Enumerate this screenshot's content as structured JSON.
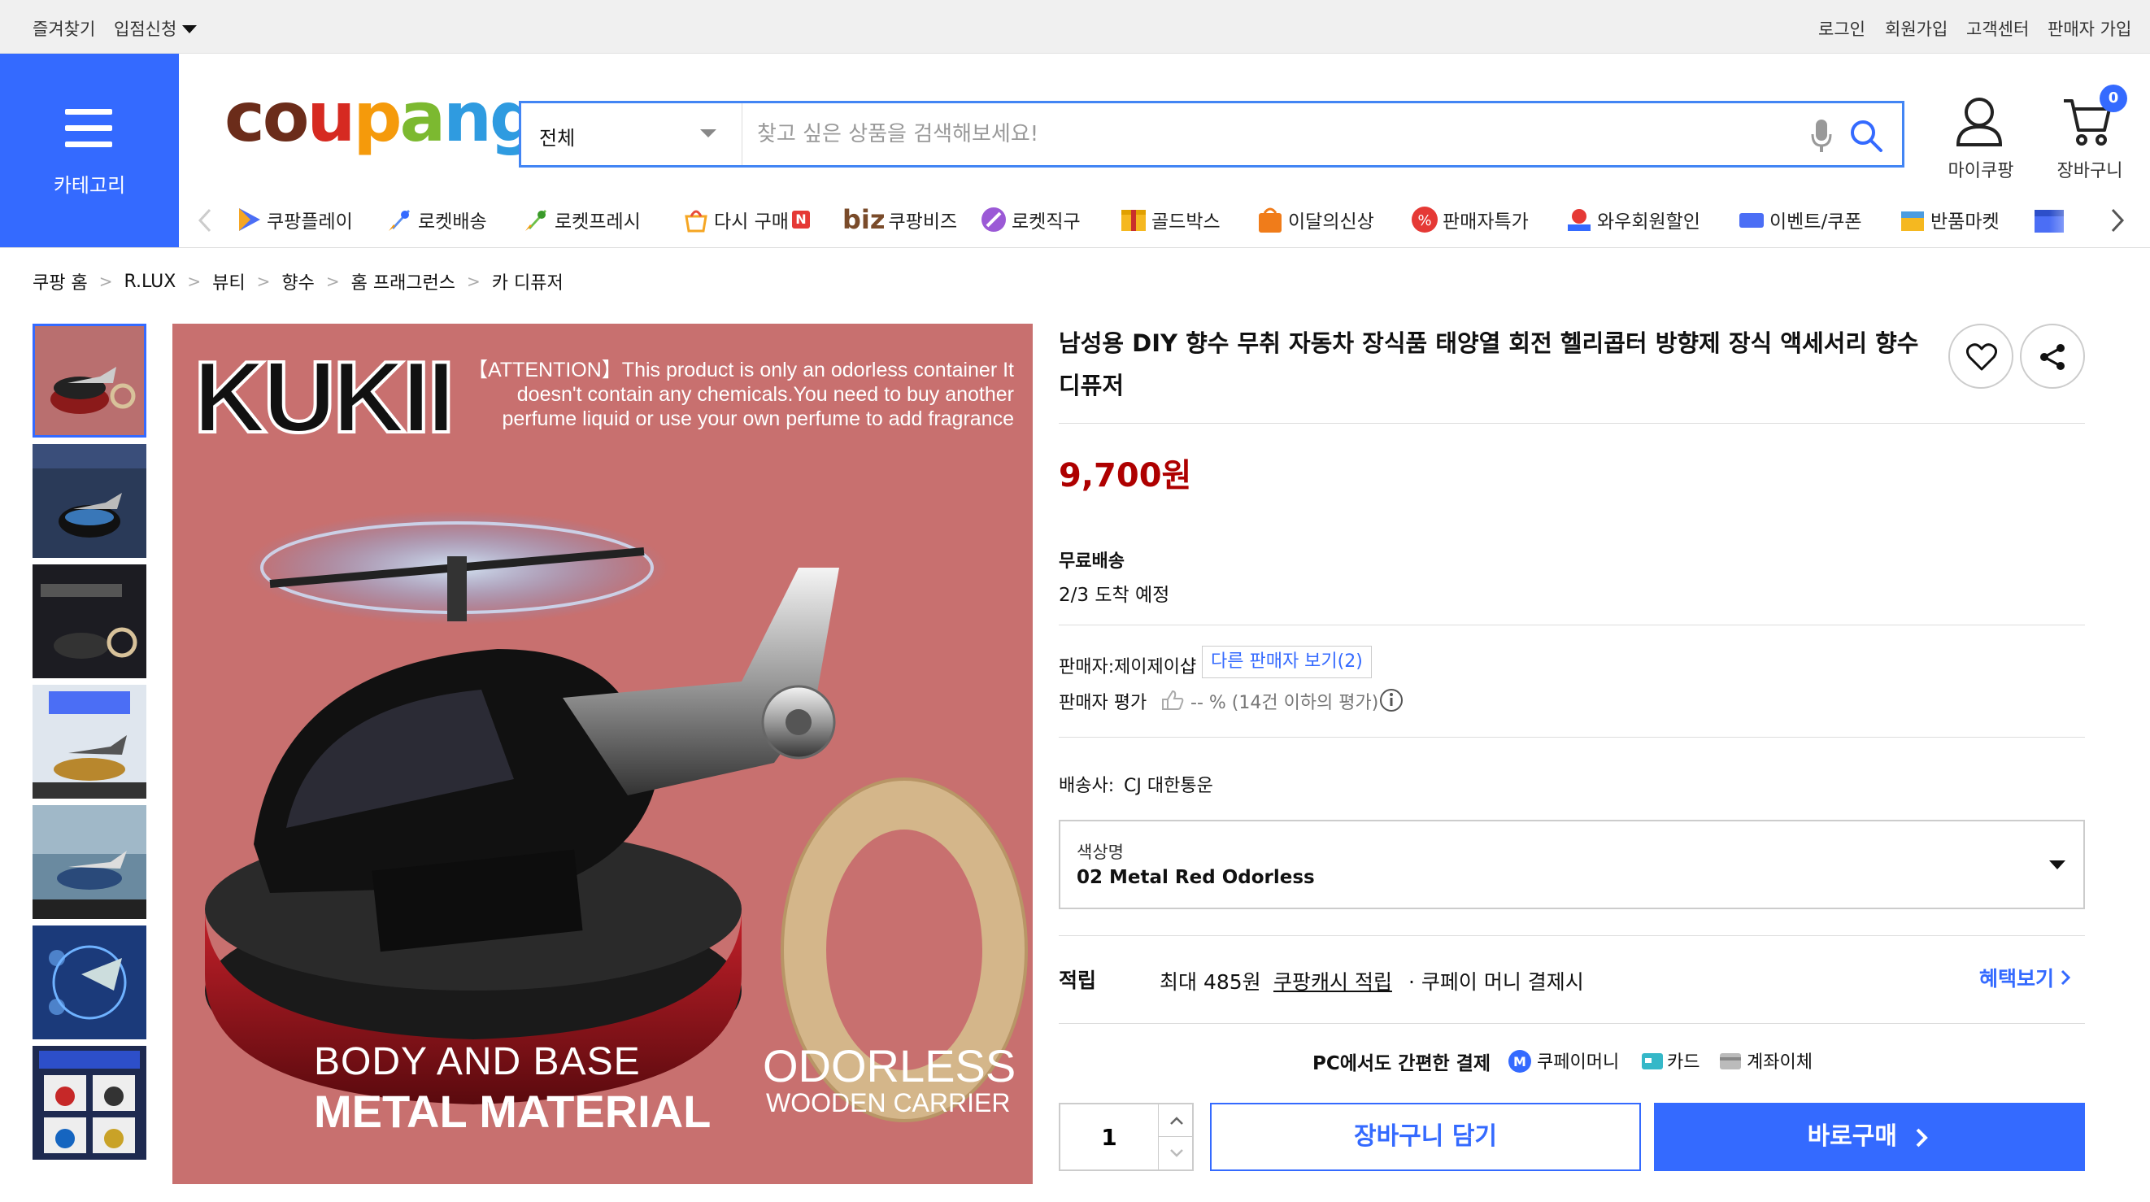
{
  "topbar": {
    "favorites": "즐겨찾기",
    "apply": "입점신청",
    "login": "로그인",
    "signup": "회원가입",
    "support": "고객센터",
    "seller_signup": "판매자 가입"
  },
  "header": {
    "category_label": "카테고리",
    "logo": "coupang",
    "search_category": "전체",
    "search_placeholder": "찾고 싶은 상품을 검색해보세요!",
    "mycoupang": "마이쿠팡",
    "cart": "장바구니",
    "cart_count": "0"
  },
  "nav": [
    {
      "label": "쿠팡플레이",
      "icon": "play-icon"
    },
    {
      "label": "로켓배송",
      "icon": "rocket-icon"
    },
    {
      "label": "로켓프레시",
      "icon": "rocket-fresh-icon"
    },
    {
      "label": "다시 구매",
      "icon": "rebuy-icon",
      "badge": "N"
    },
    {
      "label": "쿠팡비즈",
      "icon": "biz-icon",
      "prefix": "biz"
    },
    {
      "label": "로켓직구",
      "icon": "rocket-global-icon"
    },
    {
      "label": "골드박스",
      "icon": "goldbox-icon"
    },
    {
      "label": "이달의신상",
      "icon": "new-bag-icon"
    },
    {
      "label": "판매자특가",
      "icon": "percent-icon"
    },
    {
      "label": "와우회원할인",
      "icon": "wow-icon"
    },
    {
      "label": "이벤트/쿠폰",
      "icon": "coupon-icon"
    },
    {
      "label": "반품마켓",
      "icon": "return-market-icon"
    }
  ],
  "breadcrumb": [
    "쿠팡 홈",
    "R.LUX",
    "뷰티",
    "향수",
    "홈 프래그런스",
    "카 디퓨저"
  ],
  "product": {
    "title": "남성용 DIY 향수 무취 자동차 장식품 태양열 회전 헬리콥터 방향제 장식 액세서리 향수 디퓨저",
    "price": "9,700원",
    "shipping_label": "무료배송",
    "arrival": "2/3 도착 예정",
    "seller_label": "판매자:",
    "seller": "제이제이샵",
    "other_sellers": "다른 판매자 보기(2)",
    "rating_label": "판매자 평가",
    "rating_text": "-- % (14건 이하의 평가)",
    "courier_label": "배송사:",
    "courier": "CJ 대한통운",
    "option_label": "색상명",
    "option_value": "02 Metal Red Odorless",
    "reward_label": "적립",
    "reward_max": "최대 485원",
    "reward_cash": "쿠팡캐시 적립",
    "reward_note": "· 쿠페이 머니 결제시",
    "benefit_link": "혜택보기",
    "pc_pay": "PC에서도 간편한 결제",
    "pay_money": "쿠페이머니",
    "pay_card": "카드",
    "pay_transfer": "계좌이체",
    "quantity": "1",
    "add_cart": "장바구니 담기",
    "buy_now": "바로구매"
  },
  "main_image": {
    "brand": "KUKII",
    "attention": "【ATTENTION】This product is only an odorless container It doesn't contain any chemicals.You need to buy another perfume liquid or use your own perfume to add fragrance",
    "body_line1": "BODY AND BASE",
    "body_line2": "METAL MATERIAL",
    "odor_line1": "ODORLESS",
    "odor_line2": "WOODEN CARRIER"
  },
  "colors": {
    "brand_blue": "#346aff",
    "price_red": "#ae0000",
    "image_bg": "#c8706f"
  }
}
